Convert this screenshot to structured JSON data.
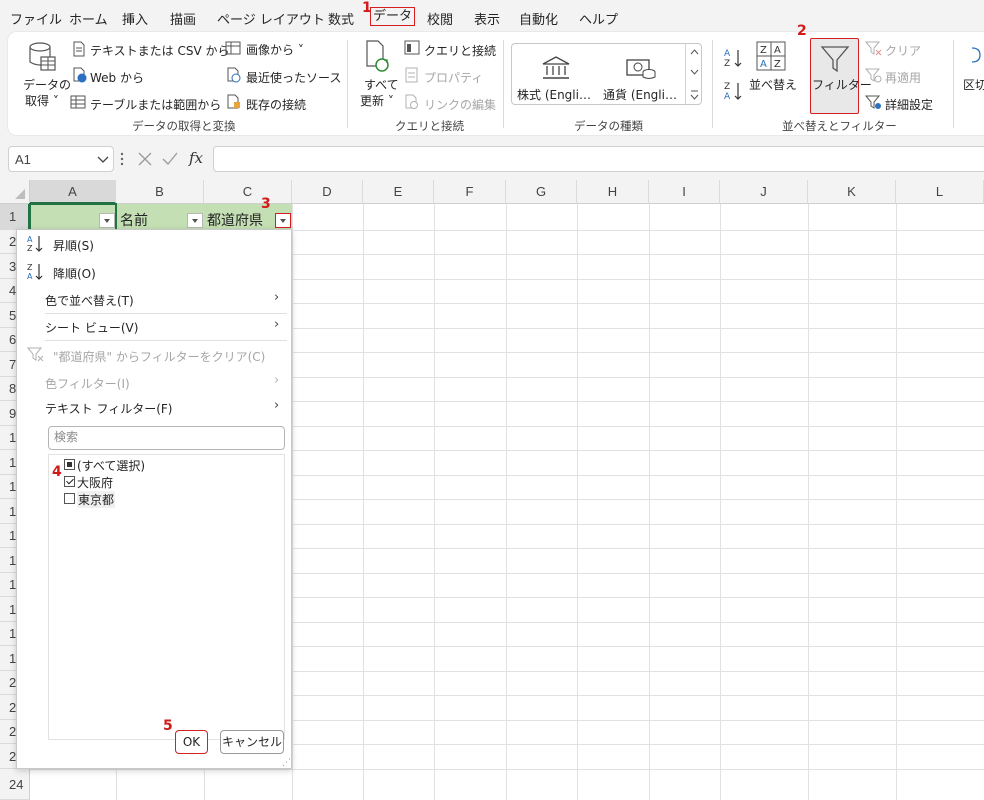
{
  "menu": {
    "items": [
      "ファイル",
      "ホーム",
      "挿入",
      "描画",
      "ページ レイアウト",
      "数式",
      "データ",
      "校閲",
      "表示",
      "自動化",
      "ヘルプ"
    ],
    "active": "データ"
  },
  "step_markers": [
    "1",
    "2",
    "3",
    "4",
    "5"
  ],
  "ribbon": {
    "get_transform": {
      "get_data_l1": "データの",
      "get_data_l2": "取得 ˅",
      "text_csv": "テキストまたは CSV から",
      "web": "Web から",
      "table_range": "テーブルまたは範囲から",
      "from_image": "画像から ˅",
      "recent_sources": "最近使ったソース",
      "existing_connections": "既存の接続",
      "group_label": "データの取得と変換"
    },
    "queries": {
      "refresh_l1": "すべて",
      "refresh_l2": "更新 ˅",
      "queries_connections": "クエリと接続",
      "properties": "プロパティ",
      "edit_links": "リンクの編集",
      "group_label": "クエリと接続"
    },
    "data_types": {
      "stocks": "株式 (Engli…",
      "currency": "通貨 (Engli…",
      "group_label": "データの種類"
    },
    "sort_filter": {
      "sort": "並べ替え",
      "filter": "フィルター",
      "clear": "クリア",
      "reapply": "再適用",
      "advanced": "詳細設定",
      "group_label": "並べ替えとフィルター"
    },
    "data_tools": {
      "text_to_columns": "区切"
    }
  },
  "formula_bar": {
    "name_box": "A1",
    "fx": "fx",
    "formula": ""
  },
  "grid": {
    "columns": [
      "A",
      "B",
      "C",
      "D",
      "E",
      "F",
      "G",
      "H",
      "I",
      "J",
      "K",
      "L"
    ],
    "rows": [
      "1",
      "2",
      "3",
      "4",
      "5",
      "6",
      "7",
      "8",
      "9",
      "1",
      "1",
      "1",
      "1",
      "1",
      "1",
      "1",
      "1",
      "1",
      "1",
      "2",
      "2",
      "2",
      "2",
      "24"
    ],
    "header_cells": {
      "A1": "",
      "B1": "名前",
      "C1": "都道府県"
    }
  },
  "filter_dropdown": {
    "sort_asc": "昇順(S)",
    "sort_desc": "降順(O)",
    "sort_by_color": "色で並べ替え(T)",
    "sheet_view": "シート ビュー(V)",
    "clear_filter": "\"都道府県\" からフィルターをクリア(C)",
    "color_filter": "色フィルター(I)",
    "text_filter": "テキスト フィルター(F)",
    "search_placeholder": "検索",
    "items": [
      {
        "label": "(すべて選択)",
        "state": "partial"
      },
      {
        "label": "大阪府",
        "state": "checked"
      },
      {
        "label": "東京都",
        "state": "unchecked"
      }
    ],
    "ok": "OK",
    "cancel": "キャンセル"
  }
}
